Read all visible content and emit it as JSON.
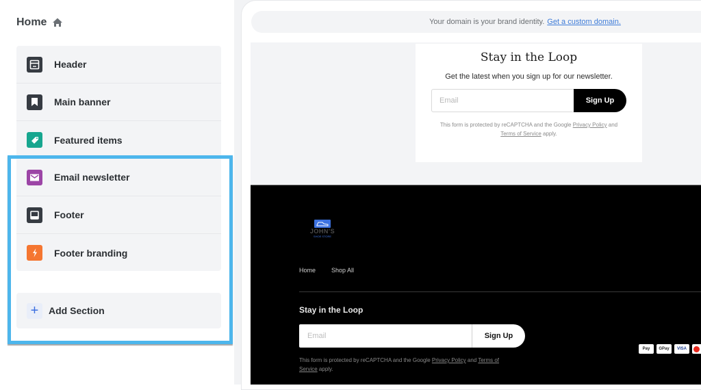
{
  "sidebar": {
    "title": "Home",
    "title_icon": "home-icon",
    "sections": [
      {
        "label": "Header",
        "icon": "header-layout-icon",
        "color": "#363b42"
      },
      {
        "label": "Main banner",
        "icon": "bookmark-icon",
        "color": "#363b42"
      },
      {
        "label": "Featured items",
        "icon": "tag-icon",
        "color": "#17a68f"
      },
      {
        "label": "Email newsletter",
        "icon": "envelope-icon",
        "color": "#9c45a6"
      },
      {
        "label": "Footer",
        "icon": "footer-layout-icon",
        "color": "#363b42"
      },
      {
        "label": "Footer branding",
        "icon": "lightning-bolt-icon",
        "color": "#f57631"
      }
    ],
    "add_section_label": "Add Section",
    "add_section_icon": "plus-icon",
    "highlight_color": "#4db6ec"
  },
  "preview": {
    "domain_banner": {
      "text": "Your domain is your brand identity.",
      "link": "Get a custom domain."
    },
    "newsletter": {
      "title": "Stay in the Loop",
      "subtitle": "Get the latest when you sign up for our newsletter.",
      "email_placeholder": "Email",
      "button": "Sign Up",
      "legal_prefix": "This form is protected by reCAPTCHA and the Google",
      "privacy": "Privacy Policy",
      "and": "and",
      "terms": "Terms of Service",
      "apply": "apply."
    },
    "footer": {
      "logo_name": "JOHN'S",
      "logo_tag": "SHOE STORE",
      "nav": [
        "Home",
        "Shop All"
      ],
      "title": "Stay in the Loop",
      "email_placeholder": "Email",
      "button": "Sign Up",
      "legal_prefix": "This form is protected by reCAPTCHA and the Google",
      "privacy": "Privacy Policy",
      "and": "and",
      "terms": "Terms of Service",
      "apply": "apply.",
      "payments": [
        "Apple Pay",
        "G Pay",
        "VISA",
        "Mastercard"
      ]
    }
  }
}
